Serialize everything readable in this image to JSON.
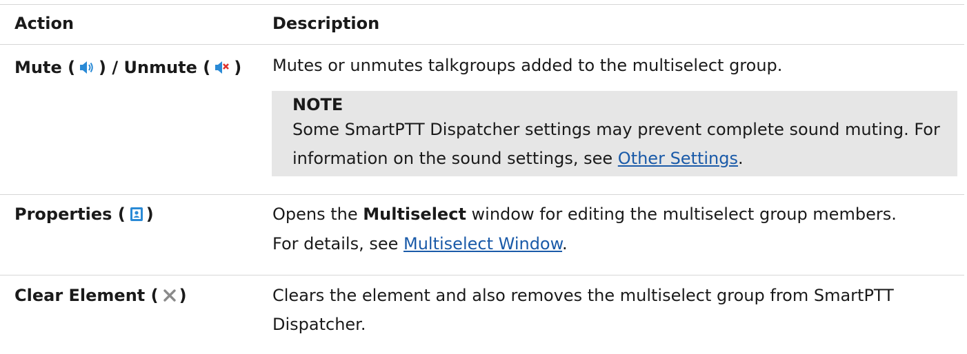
{
  "header": {
    "action": "Action",
    "description": "Description"
  },
  "rows": [
    {
      "action_a": "Mute (",
      "action_b": ") / Unmute (",
      "action_c": ")",
      "icons": [
        "speaker-icon",
        "speaker-muted-icon"
      ],
      "description": "Mutes or unmutes talkgroups added to the multiselect group.",
      "note": {
        "title": "NOTE",
        "line1": "Some SmartPTT Dispatcher settings may prevent complete sound muting. For",
        "line2_pre": "information on the sound settings, see ",
        "line2_link": "Other Settings",
        "line2_post": "."
      }
    },
    {
      "action_a": "Properties (",
      "action_b": ")",
      "icons": [
        "contact-card-icon"
      ],
      "desc_pre": "Opens the ",
      "desc_bold": "Multiselect",
      "desc_post": " window for editing the multiselect group members.",
      "line2_pre": "For details, see ",
      "line2_link": "Multiselect Window",
      "line2_post": "."
    },
    {
      "action_a": "Clear Element (",
      "action_b": ")",
      "icons": [
        "close-x-icon"
      ],
      "line1": "Clears the element and also removes the multiselect group from SmartPTT",
      "line2": "Dispatcher."
    }
  ],
  "colors": {
    "link": "#1a5aa8",
    "note_bg": "#e6e6e6",
    "rule": "#d6d6d6",
    "icon_blue": "#2a8ad6",
    "icon_red": "#e0312b",
    "icon_gray": "#8a8a8a"
  }
}
